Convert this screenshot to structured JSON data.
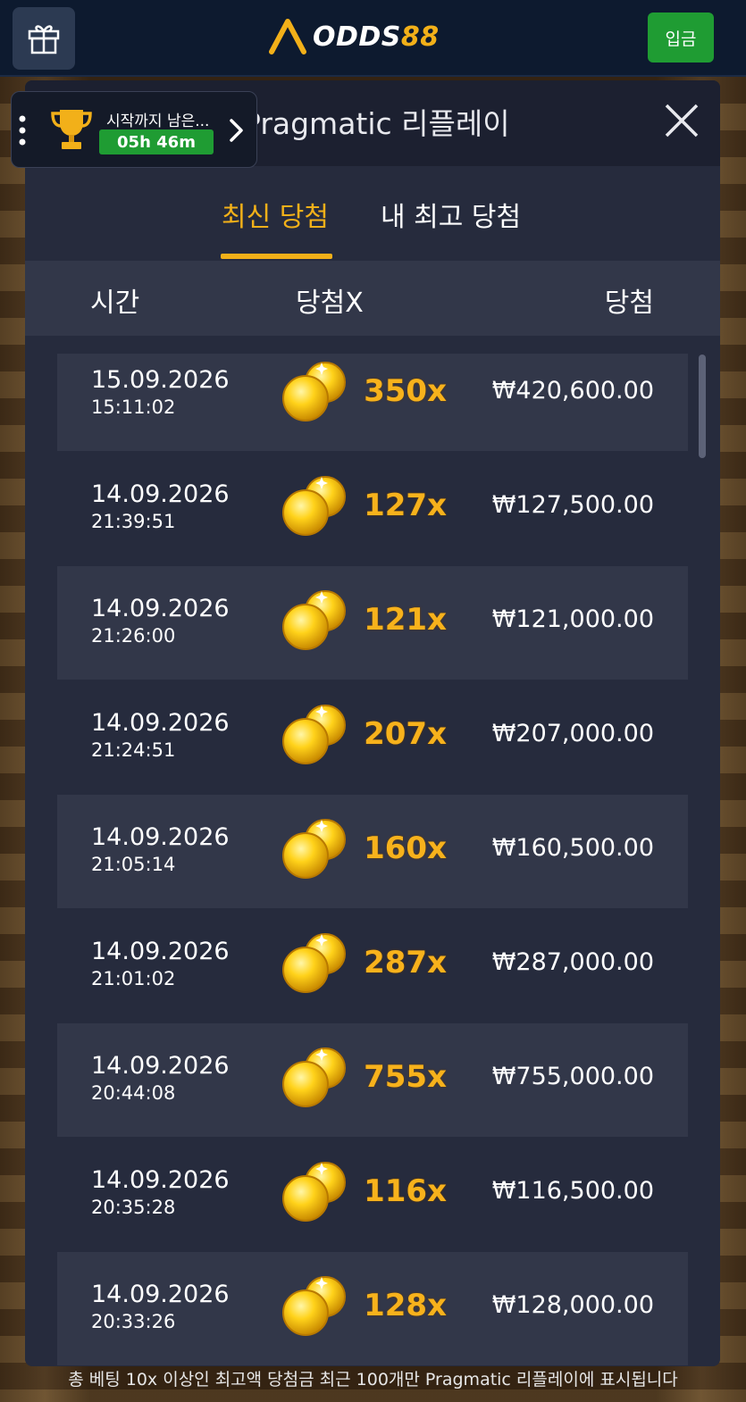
{
  "header": {
    "logo_text_main": "ODDS",
    "logo_text_accent": "88",
    "deposit_label": "입금"
  },
  "tournament": {
    "label": "시작까지 남은...",
    "timer": "05h 46m"
  },
  "modal": {
    "title": "Pragmatic 리플레이",
    "tabs": [
      {
        "label": "최신 당첨",
        "active": true
      },
      {
        "label": "내 최고 당첨",
        "active": false
      }
    ],
    "columns": {
      "time": "시간",
      "multiplier": "당첨X",
      "win": "당첨"
    },
    "rows": [
      {
        "date": "15.09.2026",
        "time": "15:11:02",
        "multiplier": "350x",
        "amount": "₩420,600.00"
      },
      {
        "date": "14.09.2026",
        "time": "21:39:51",
        "multiplier": "127x",
        "amount": "₩127,500.00"
      },
      {
        "date": "14.09.2026",
        "time": "21:26:00",
        "multiplier": "121x",
        "amount": "₩121,000.00"
      },
      {
        "date": "14.09.2026",
        "time": "21:24:51",
        "multiplier": "207x",
        "amount": "₩207,000.00"
      },
      {
        "date": "14.09.2026",
        "time": "21:05:14",
        "multiplier": "160x",
        "amount": "₩160,500.00"
      },
      {
        "date": "14.09.2026",
        "time": "21:01:02",
        "multiplier": "287x",
        "amount": "₩287,000.00"
      },
      {
        "date": "14.09.2026",
        "time": "20:44:08",
        "multiplier": "755x",
        "amount": "₩755,000.00"
      },
      {
        "date": "14.09.2026",
        "time": "20:35:28",
        "multiplier": "116x",
        "amount": "₩116,500.00"
      },
      {
        "date": "14.09.2026",
        "time": "20:33:26",
        "multiplier": "128x",
        "amount": "₩128,000.00"
      }
    ]
  },
  "footer_note": "총 베팅 10x 이상인 최고액 당첨금 최근 100개만 Pragmatic 리플레이에 표시됩니다",
  "colors": {
    "accent_gold": "#f2b019",
    "deposit_green": "#1f9c33",
    "modal_bg": "#262b3d",
    "row_shaded_bg": "#323749"
  }
}
